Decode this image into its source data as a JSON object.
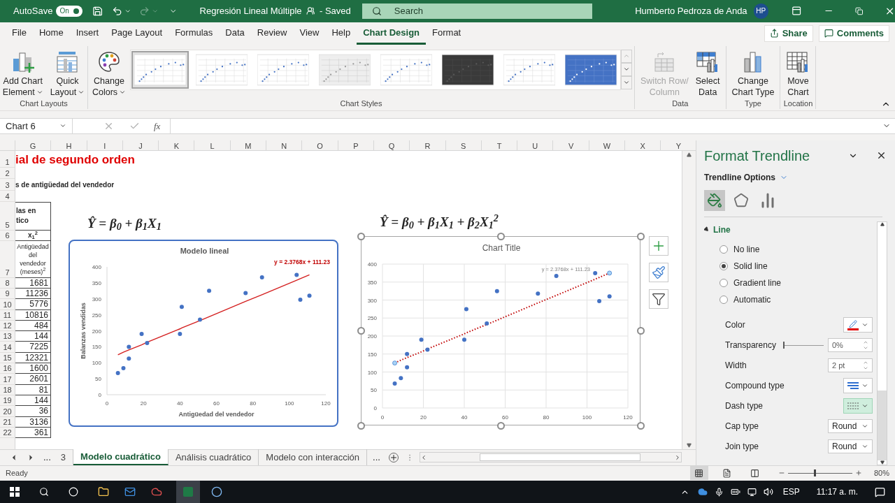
{
  "title_bar": {
    "autosave_label": "AutoSave",
    "autosave_toggle": {
      "label": "On",
      "on": true
    },
    "document_title": "Regresión Lineal Múltiple",
    "save_status": "- Saved",
    "search": {
      "placeholder": "Search"
    },
    "user_name": "Humberto Pedroza de Anda",
    "avatar_initials": "HP"
  },
  "ribbon_tabs": [
    {
      "label": "File",
      "selected": false
    },
    {
      "label": "Home",
      "selected": false
    },
    {
      "label": "Insert",
      "selected": false
    },
    {
      "label": "Page Layout",
      "selected": false
    },
    {
      "label": "Formulas",
      "selected": false
    },
    {
      "label": "Data",
      "selected": false
    },
    {
      "label": "Review",
      "selected": false
    },
    {
      "label": "View",
      "selected": false
    },
    {
      "label": "Help",
      "selected": false
    },
    {
      "label": "Chart Design",
      "selected": true
    },
    {
      "label": "Format",
      "selected": false
    }
  ],
  "share_button": {
    "label": "Share"
  },
  "comments_button": {
    "label": "Comments"
  },
  "ribbon_groups": [
    {
      "label": "Chart Layouts",
      "commands": [
        {
          "kind": "add-chart",
          "lines": [
            "Add Chart",
            "Element"
          ],
          "dropdown": true,
          "disabled": false
        },
        {
          "kind": "quick-layout",
          "lines": [
            "Quick",
            "Layout"
          ],
          "dropdown": true,
          "disabled": false
        }
      ]
    },
    {
      "label": "Chart Styles",
      "commands": [
        {
          "kind": "colors",
          "lines": [
            "Change",
            "Colors"
          ],
          "dropdown": true,
          "disabled": false
        }
      ],
      "styles": [
        {
          "kind": "light",
          "selected": true
        },
        {
          "kind": "light",
          "selected": false
        },
        {
          "kind": "light",
          "selected": false
        },
        {
          "kind": "gray",
          "selected": false
        },
        {
          "kind": "light",
          "selected": false
        },
        {
          "kind": "dark",
          "selected": false
        },
        {
          "kind": "light",
          "selected": false
        },
        {
          "kind": "blue",
          "selected": false
        }
      ]
    },
    {
      "label": "Data",
      "commands": [
        {
          "kind": "switch",
          "lines": [
            "Switch Row/",
            "Column"
          ],
          "dropdown": false,
          "disabled": true
        },
        {
          "kind": "select-data",
          "lines": [
            "Select",
            "Data"
          ],
          "dropdown": false,
          "disabled": false
        }
      ]
    },
    {
      "label": "Type",
      "commands": [
        {
          "kind": "chart-type",
          "lines": [
            "Change",
            "Chart Type"
          ],
          "dropdown": false,
          "disabled": false
        }
      ]
    },
    {
      "label": "Location",
      "commands": [
        {
          "kind": "move",
          "lines": [
            "Move",
            "Chart"
          ],
          "dropdown": false,
          "disabled": false
        }
      ]
    }
  ],
  "formula_bar": {
    "name_box": "Chart 6",
    "function_label": "fx"
  },
  "sheet": {
    "columns": [
      "G",
      "H",
      "I",
      "J",
      "K",
      "L",
      "M",
      "N",
      "O",
      "P",
      "Q",
      "R",
      "S",
      "T",
      "U",
      "V",
      "W",
      "X",
      "Y"
    ],
    "rows": [
      "1",
      "2",
      "3",
      "4",
      "5",
      "6",
      "7",
      "8",
      "9",
      "10",
      "11",
      "12",
      "13",
      "14",
      "15",
      "16",
      "17",
      "18",
      "19",
      "20",
      "21",
      "22"
    ],
    "title_text": "ial de segundo orden",
    "subtitle_text": "s de antigüedad del vendedor",
    "table": {
      "header_lines": [
        "las en",
        "tico"
      ],
      "variable": "x$_{1}$$^{2}$",
      "description": "Antigüedad del vendedor (meses)$^{2}$",
      "values": [
        "1681",
        "11236",
        "5776",
        "10816",
        "484",
        "144",
        "7225",
        "12321",
        "1600",
        "2601",
        "81",
        "144",
        "36",
        "3136",
        "361"
      ]
    },
    "charts": [
      {
        "kind": "framed",
        "formula": "Ŷ = β$_{0}$ + β$_{1}$X$_{1}$",
        "selected": false,
        "trendline": {
          "selected": false
        },
        "chart_data": {
          "type": "scatter",
          "grid": false,
          "title": "Modelo lineal",
          "xlabel": "Antigüedad del vendedor",
          "ylabel": "Balanzas vendidas",
          "x": [
            6,
            9,
            12,
            12,
            19,
            22,
            40,
            41,
            51,
            56,
            76,
            85,
            104,
            106,
            111
          ],
          "series": [
            {
              "color": "#4472c4",
              "values": [
                68,
                83,
                150,
                113,
                190,
                162,
                190,
                275,
                235,
                325,
                318,
                367,
                375,
                297,
                310
              ]
            },
            {
              "type": "line",
              "line_style": "solid",
              "color": "#d42020",
              "values": [
                125,
                133,
                140,
                140,
                156,
                164,
                206,
                209,
                232,
                244,
                292,
                313,
                358,
                363,
                375
              ]
            }
          ],
          "xlim": [
            0,
            120
          ],
          "ylim": [
            0,
            400
          ],
          "xticks": [
            0,
            20,
            40,
            60,
            80,
            100,
            120
          ],
          "yticks": [
            0,
            50,
            100,
            150,
            200,
            250,
            300,
            350,
            400
          ],
          "annotations": [
            "y = 2.3768x + 111.23"
          ]
        }
      },
      {
        "kind": "gridded",
        "formula": "Ŷ = β$_{0}$ + β$_{1}$X$_{1}$ + β$_{2}$X$_{1}$$^{2}$",
        "selected": true,
        "trendline": {
          "selected": true
        },
        "chart_data": {
          "type": "scatter",
          "grid": true,
          "title": "Chart Title",
          "x": [
            6,
            9,
            12,
            12,
            19,
            22,
            40,
            41,
            51,
            56,
            76,
            85,
            104,
            106,
            111
          ],
          "series": [
            {
              "color": "#4472c4",
              "values": [
                68,
                83,
                150,
                113,
                190,
                162,
                190,
                275,
                235,
                325,
                318,
                367,
                375,
                297,
                310
              ]
            },
            {
              "type": "line",
              "line_style": "dotted",
              "color": "#c00000",
              "values": [
                125,
                133,
                140,
                140,
                156,
                164,
                206,
                209,
                232,
                244,
                292,
                313,
                358,
                363,
                375
              ]
            }
          ],
          "xlim": [
            0,
            120
          ],
          "ylim": [
            0,
            400
          ],
          "xticks": [
            0,
            20,
            40,
            60,
            80,
            100,
            120
          ],
          "yticks": [
            0,
            50,
            100,
            150,
            200,
            250,
            300,
            350,
            400
          ],
          "annotations": [
            "y = 2.3768x + 111.23"
          ]
        }
      }
    ]
  },
  "sheet_tabs": {
    "more_left": "...",
    "items": [
      {
        "label": "3",
        "selected": false
      },
      {
        "label": "Modelo cuadrático",
        "selected": true
      },
      {
        "label": "Análisis cuadrático",
        "selected": false
      },
      {
        "label": "Modelo con interacción",
        "selected": false
      }
    ],
    "more_right": "..."
  },
  "format_pane": {
    "title": "Format Trendline",
    "options_label": "Trendline Options",
    "icon_tabs": [
      {
        "kind": "fill",
        "selected": true
      },
      {
        "kind": "effects",
        "selected": false
      },
      {
        "kind": "options",
        "selected": false
      }
    ],
    "section": {
      "label": "Line",
      "expanded": true
    },
    "line_options": [
      {
        "label": "No line",
        "selected": false
      },
      {
        "label": "Solid line",
        "selected": true
      },
      {
        "label": "Gradient line",
        "selected": false
      },
      {
        "label": "Automatic",
        "selected": false
      }
    ],
    "properties": [
      {
        "kind": "color",
        "label": "Color"
      },
      {
        "kind": "slider",
        "label": "Transparency",
        "level": 0,
        "value": "0%"
      },
      {
        "kind": "spin",
        "label": "Width",
        "value": "2 pt"
      },
      {
        "kind": "compound",
        "label": "Compound type"
      },
      {
        "kind": "dash",
        "label": "Dash type",
        "hovered": true
      },
      {
        "kind": "select",
        "label": "Cap type",
        "value": "Round"
      },
      {
        "kind": "select",
        "label": "Join type",
        "value": "Round"
      }
    ]
  },
  "status_bar": {
    "status": "Ready",
    "views": [
      {
        "kind": "normal",
        "selected": true
      },
      {
        "kind": "page-layout",
        "selected": false
      },
      {
        "kind": "page-break",
        "selected": false
      }
    ],
    "zoom": {
      "level": 0.4,
      "value": "80%"
    }
  },
  "taskbar": {
    "language": "ESP",
    "time": "11:17 a. m."
  }
}
